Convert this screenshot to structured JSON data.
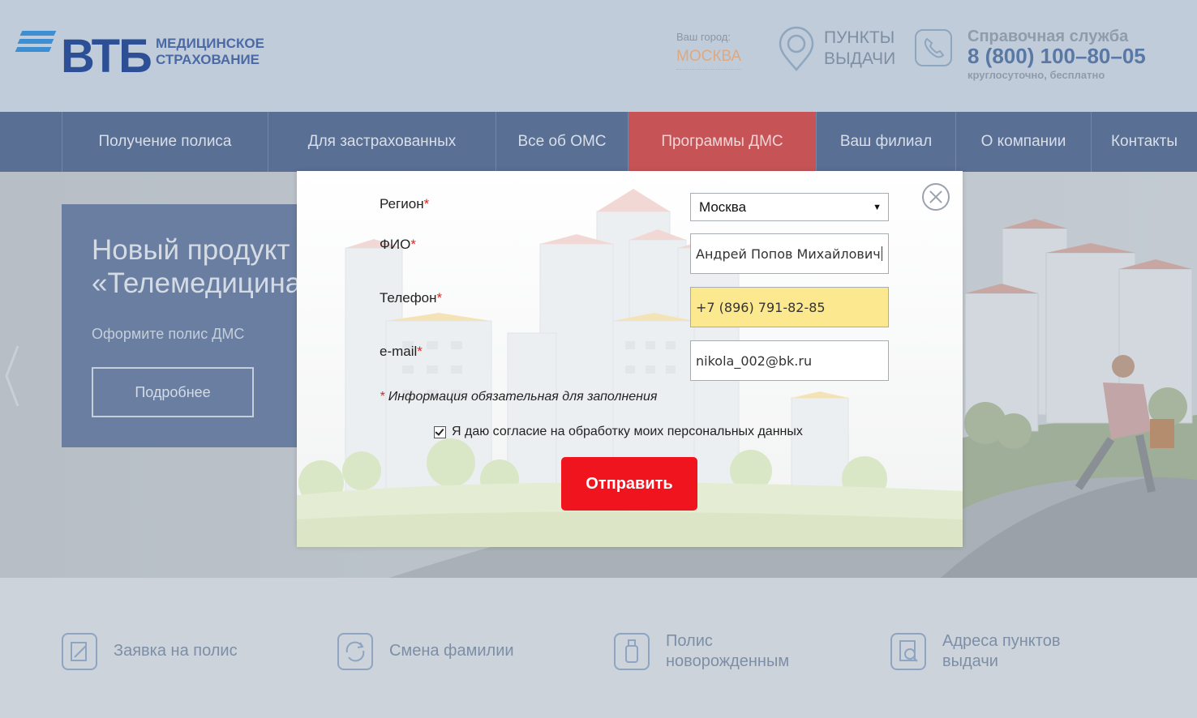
{
  "header": {
    "brand": "ВТБ",
    "brand_subtitle": "МЕДИЦИНСКОЕ СТРАХОВАНИЕ",
    "city_label": "Ваш город:",
    "city_value": "МОСКВА",
    "points_label": "ПУНКТЫ ВЫДАЧИ",
    "support_title": "Справочная служба",
    "support_phone": "8 (800) 100–80–05",
    "support_note": "круглосуточно, бесплатно"
  },
  "nav": {
    "items": [
      {
        "label": "Получение полиса"
      },
      {
        "label": "Для застрахованных"
      },
      {
        "label": "Все об ОМС"
      },
      {
        "label": "Программы ДМС"
      },
      {
        "label": "Ваш филиал"
      },
      {
        "label": "О компании"
      },
      {
        "label": "Контакты"
      }
    ],
    "active": "Программы ДМС"
  },
  "hero": {
    "title_line1": "Новый продукт",
    "title_line2": "«Телемедицина",
    "subtitle": "Оформите полис ДМС",
    "button": "Подробнее"
  },
  "quicklinks": [
    {
      "label_line1": "Заявка на полис",
      "label_line2": "",
      "icon": "document-edit-icon"
    },
    {
      "label_line1": "Смена фамилии",
      "label_line2": "",
      "icon": "refresh-icon"
    },
    {
      "label_line1": "Полис",
      "label_line2": "новорожденным",
      "icon": "baby-bottle-icon"
    },
    {
      "label_line1": "Адреса пунктов",
      "label_line2": "выдачи",
      "icon": "search-document-icon"
    }
  ],
  "form": {
    "region_label": "Регион",
    "region_value": "Москва",
    "fio_label": "ФИО",
    "fio_value": "Андрей Попов Михайлович",
    "phone_label": "Телефон",
    "phone_value": "+7 (896) 791-82-85",
    "email_label": "e-mail",
    "email_value": "nikola_002@bk.ru",
    "required_marker": "*",
    "required_note": "Информация обязательная для заполнения",
    "consent_checked": true,
    "consent_text": "Я даю согласие на обработку моих персональных данных",
    "submit_label": "Отправить"
  },
  "colors": {
    "nav_bg": "#5a6f94",
    "nav_active": "#c65457",
    "submit": "#f0141f",
    "autofill": "#fce98f",
    "brand": "#2c4f96"
  }
}
